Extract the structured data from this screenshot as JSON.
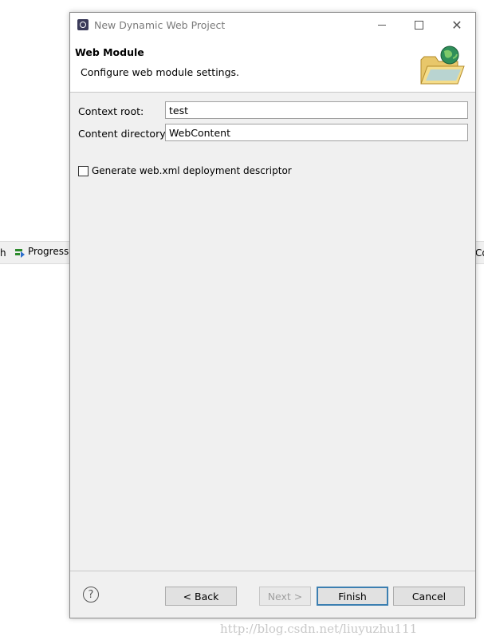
{
  "background": {
    "left_text": "h",
    "progress_label": "Progress",
    "right_text": "Co"
  },
  "dialog": {
    "title": "New Dynamic Web Project",
    "header": {
      "title": "Web Module",
      "description": "Configure web module settings."
    },
    "fields": {
      "context_root_label": "Context root:",
      "context_root_value": "test",
      "content_dir_label": "Content directory:",
      "content_dir_value": "WebContent"
    },
    "checkbox": {
      "label": "Generate web.xml deployment descriptor",
      "checked": false
    },
    "buttons": {
      "back": "< Back",
      "next": "Next >",
      "finish": "Finish",
      "cancel": "Cancel"
    }
  },
  "watermark": "http://blog.csdn.net/liuyuzhu111",
  "colors": {
    "dialog_bg": "#f0f0f0",
    "default_button_border": "#3c7fb1"
  }
}
